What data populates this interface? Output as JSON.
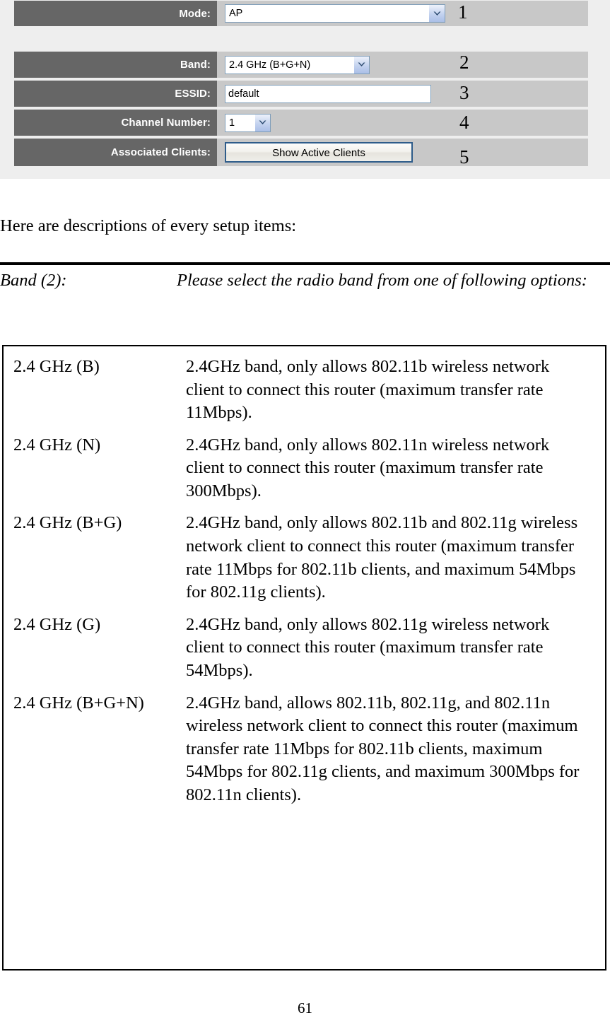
{
  "screenshot": {
    "rows": [
      {
        "label": "Mode:",
        "control": "select",
        "value": "AP",
        "callout": "1"
      },
      {
        "label": "Band:",
        "control": "select",
        "value": "2.4 GHz (B+G+N)",
        "callout": "2"
      },
      {
        "label": "ESSID:",
        "control": "text",
        "value": "default",
        "callout": "3"
      },
      {
        "label": "Channel Number:",
        "control": "select",
        "value": "1",
        "callout": "4"
      },
      {
        "label": "Associated Clients:",
        "control": "button",
        "value": "Show Active Clients",
        "callout": "5"
      }
    ],
    "colors": {
      "label_bg": "#666666",
      "row_bg": "#c8c8c8",
      "panel_bg": "#eeeeee",
      "input_border": "#7e9db9",
      "button_border": "#2e5c8a",
      "arrow_fill": "#c3d2ef"
    }
  },
  "document": {
    "intro": "Here are descriptions of every setup items:",
    "definition": {
      "term": "Band (2):",
      "description": "Please select the radio band from one of following options:"
    },
    "options_table": [
      {
        "name": "2.4 GHz (B)",
        "description": "2.4GHz band, only allows 802.11b wireless network client to connect this router (maximum transfer rate 11Mbps)."
      },
      {
        "name": "2.4 GHz (N)",
        "description": "2.4GHz band, only allows 802.11n wireless network client to connect this router (maximum transfer rate 300Mbps)."
      },
      {
        "name": "2.4 GHz (B+G)",
        "description": "2.4GHz band, only allows 802.11b and 802.11g wireless network client to connect this router (maximum transfer rate 11Mbps for 802.11b clients, and maximum 54Mbps for 802.11g clients)."
      },
      {
        "name": "2.4 GHz (G)",
        "description": "2.4GHz band, only allows 802.11g wireless network client to connect this router (maximum transfer rate 54Mbps)."
      },
      {
        "name": "2.4 GHz (B+G+N)",
        "description": "2.4GHz band, allows 802.11b, 802.11g, and 802.11n wireless network client to connect this router (maximum transfer rate 11Mbps for 802.11b clients, maximum 54Mbps for 802.11g clients, and maximum 300Mbps for 802.11n clients)."
      }
    ],
    "page_number": "61"
  }
}
